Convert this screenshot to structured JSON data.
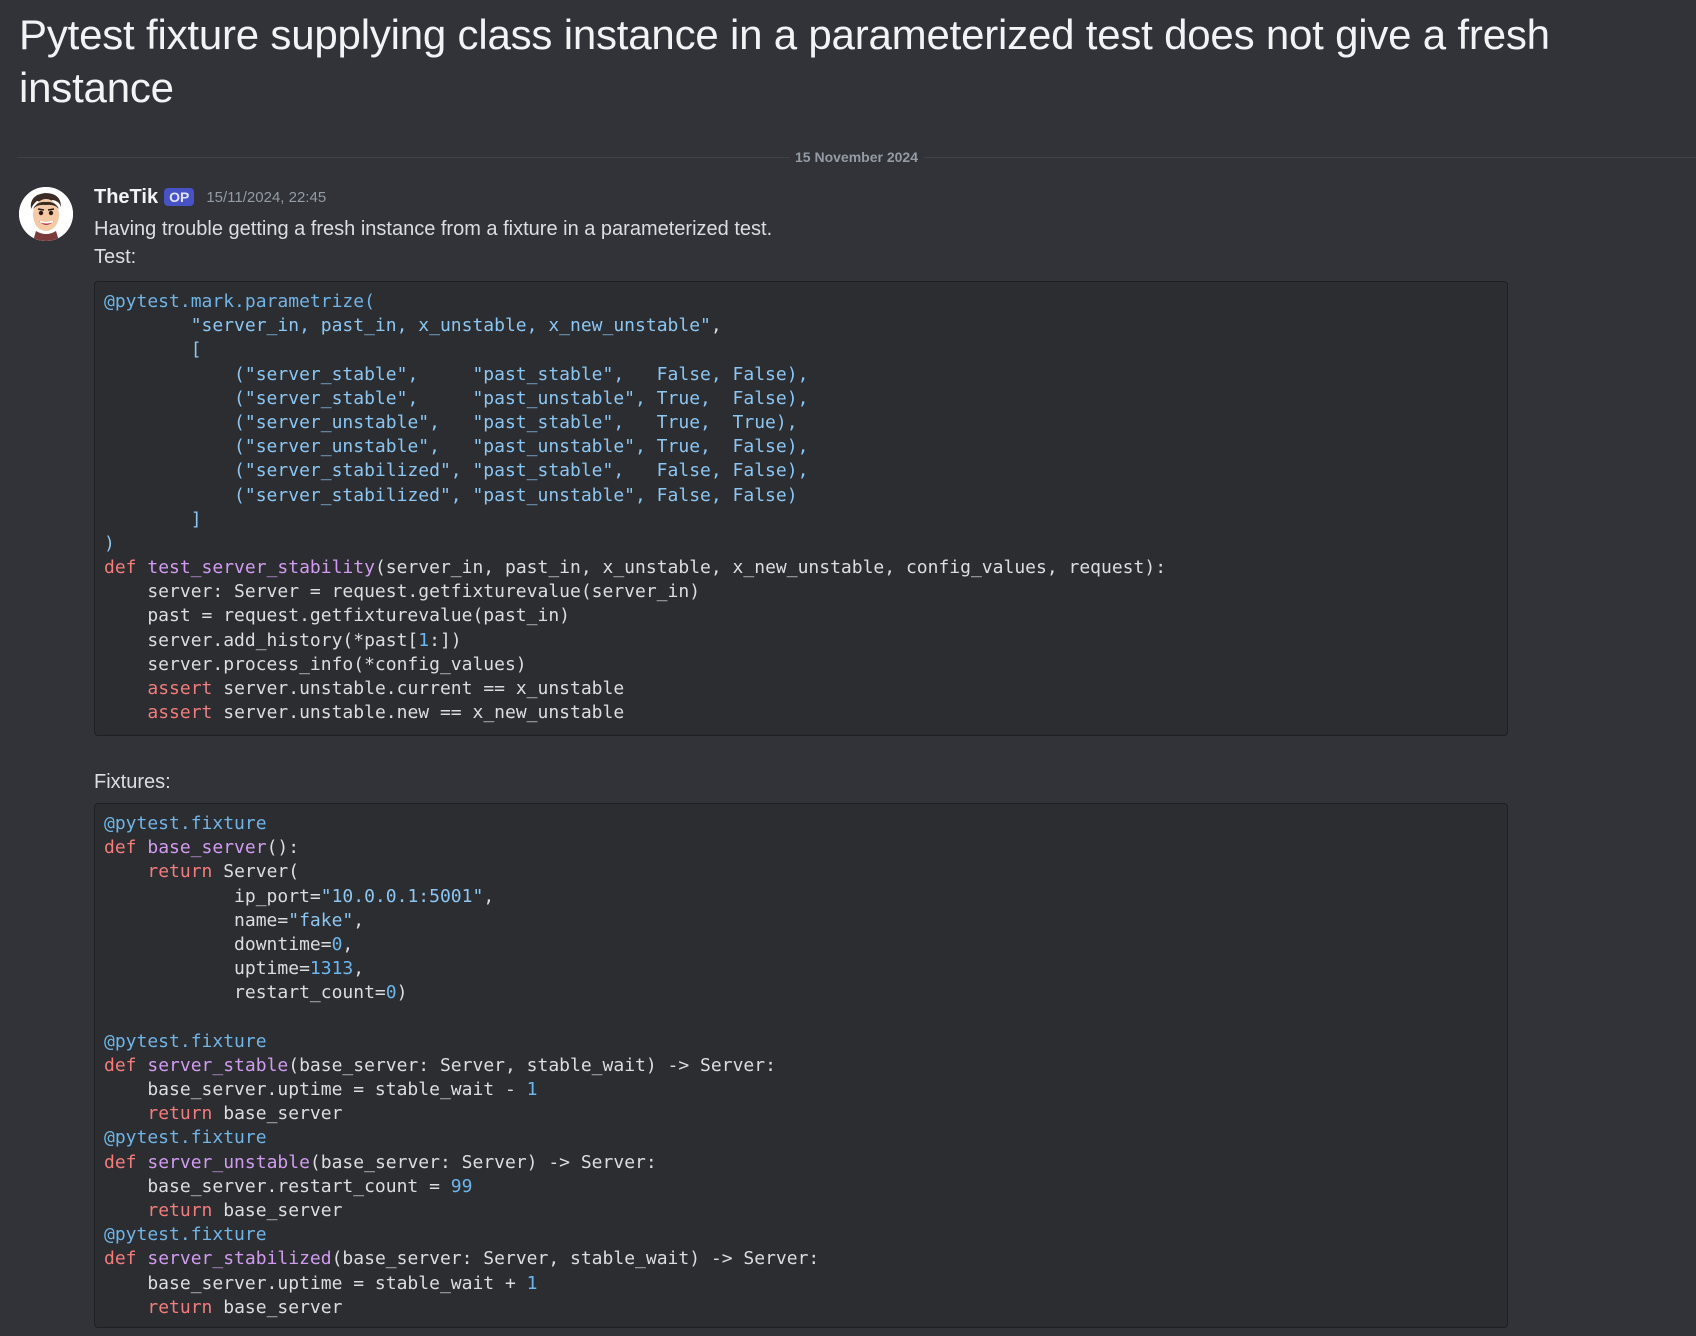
{
  "thread": {
    "title": "Pytest fixture supplying class instance in a parameterized test does not give a fresh instance"
  },
  "date_divider": "15 November 2024",
  "message": {
    "author": "TheTik",
    "badge": "OP",
    "timestamp": "15/11/2024, 22:45",
    "avatar_icon": "cartoon-face-avatar",
    "lines": {
      "intro": "Having trouble getting a fresh instance from a fixture in a parameterized test.",
      "test_label": "Test:",
      "fixtures_label": "Fixtures:"
    }
  },
  "code_colors": {
    "decorator": "#71b4e6",
    "keyword": "#f47c7c",
    "function": "#d19cf0",
    "string": "#8cc6f2",
    "number": "#6db6ee",
    "plain": "#dbdee1"
  },
  "code_blocks": {
    "test": [
      [
        [
          "dec",
          "@pytest.mark.parametrize("
        ]
      ],
      [
        [
          "plain",
          "        "
        ],
        [
          "str",
          "\"server_in, past_in, x_unstable, x_new_unstable\""
        ],
        [
          "plain",
          ","
        ]
      ],
      [
        [
          "plain",
          "        "
        ],
        [
          "str",
          "["
        ]
      ],
      [
        [
          "plain",
          "            "
        ],
        [
          "str",
          "(\"server_stable\",     \"past_stable\",   False, False),"
        ]
      ],
      [
        [
          "plain",
          "            "
        ],
        [
          "str",
          "(\"server_stable\",     \"past_unstable\", True,  False),"
        ]
      ],
      [
        [
          "plain",
          "            "
        ],
        [
          "str",
          "(\"server_unstable\",   \"past_stable\",   True,  True),"
        ]
      ],
      [
        [
          "plain",
          "            "
        ],
        [
          "str",
          "(\"server_unstable\",   \"past_unstable\", True,  False),"
        ]
      ],
      [
        [
          "plain",
          "            "
        ],
        [
          "str",
          "(\"server_stabilized\", \"past_stable\",   False, False),"
        ]
      ],
      [
        [
          "plain",
          "            "
        ],
        [
          "str",
          "(\"server_stabilized\", \"past_unstable\", False, False)"
        ]
      ],
      [
        [
          "plain",
          "        "
        ],
        [
          "str",
          "]"
        ]
      ],
      [
        [
          "str",
          ")"
        ]
      ],
      [
        [
          "kw",
          "def "
        ],
        [
          "fn",
          "test_server_stability"
        ],
        [
          "plain",
          "(server_in, past_in, x_unstable, x_new_unstable, config_values, request):"
        ]
      ],
      [
        [
          "plain",
          "    server: Server = request.getfixturevalue(server_in)"
        ]
      ],
      [
        [
          "plain",
          "    past = request.getfixturevalue(past_in)"
        ]
      ],
      [
        [
          "plain",
          "    server.add_history(*past["
        ],
        [
          "num",
          "1"
        ],
        [
          "plain",
          ":])"
        ]
      ],
      [
        [
          "plain",
          "    server.process_info(*config_values)"
        ]
      ],
      [
        [
          "plain",
          "    "
        ],
        [
          "kw",
          "assert"
        ],
        [
          "plain",
          " server.unstable.current == x_unstable"
        ]
      ],
      [
        [
          "plain",
          "    "
        ],
        [
          "kw",
          "assert"
        ],
        [
          "plain",
          " server.unstable.new == x_new_unstable"
        ]
      ]
    ],
    "fixtures": [
      [
        [
          "dec",
          "@pytest.fixture"
        ]
      ],
      [
        [
          "kw",
          "def "
        ],
        [
          "fn",
          "base_server"
        ],
        [
          "plain",
          "():"
        ]
      ],
      [
        [
          "plain",
          "    "
        ],
        [
          "kw",
          "return"
        ],
        [
          "plain",
          " Server("
        ]
      ],
      [
        [
          "plain",
          "            ip_port="
        ],
        [
          "str",
          "\"10.0.0.1:5001\""
        ],
        [
          "plain",
          ","
        ]
      ],
      [
        [
          "plain",
          "            name="
        ],
        [
          "str",
          "\"fake\""
        ],
        [
          "plain",
          ","
        ]
      ],
      [
        [
          "plain",
          "            downtime="
        ],
        [
          "num",
          "0"
        ],
        [
          "plain",
          ","
        ]
      ],
      [
        [
          "plain",
          "            uptime="
        ],
        [
          "num",
          "1313"
        ],
        [
          "plain",
          ","
        ]
      ],
      [
        [
          "plain",
          "            restart_count="
        ],
        [
          "num",
          "0"
        ],
        [
          "plain",
          ")"
        ]
      ],
      [
        [
          "plain",
          ""
        ]
      ],
      [
        [
          "dec",
          "@pytest.fixture"
        ]
      ],
      [
        [
          "kw",
          "def "
        ],
        [
          "fn",
          "server_stable"
        ],
        [
          "plain",
          "(base_server: Server, stable_wait) -> Server:"
        ]
      ],
      [
        [
          "plain",
          "    base_server.uptime = stable_wait - "
        ],
        [
          "num",
          "1"
        ]
      ],
      [
        [
          "plain",
          "    "
        ],
        [
          "kw",
          "return"
        ],
        [
          "plain",
          " base_server"
        ]
      ],
      [
        [
          "dec",
          "@pytest.fixture"
        ]
      ],
      [
        [
          "kw",
          "def "
        ],
        [
          "fn",
          "server_unstable"
        ],
        [
          "plain",
          "(base_server: Server) -> Server:"
        ]
      ],
      [
        [
          "plain",
          "    base_server.restart_count = "
        ],
        [
          "num",
          "99"
        ]
      ],
      [
        [
          "plain",
          "    "
        ],
        [
          "kw",
          "return"
        ],
        [
          "plain",
          " base_server"
        ]
      ],
      [
        [
          "dec",
          "@pytest.fixture"
        ]
      ],
      [
        [
          "kw",
          "def "
        ],
        [
          "fn",
          "server_stabilized"
        ],
        [
          "plain",
          "(base_server: Server, stable_wait) -> Server:"
        ]
      ],
      [
        [
          "plain",
          "    base_server.uptime = stable_wait + "
        ],
        [
          "num",
          "1"
        ]
      ],
      [
        [
          "plain",
          "    "
        ],
        [
          "kw",
          "return"
        ],
        [
          "plain",
          " base_server"
        ]
      ]
    ]
  }
}
